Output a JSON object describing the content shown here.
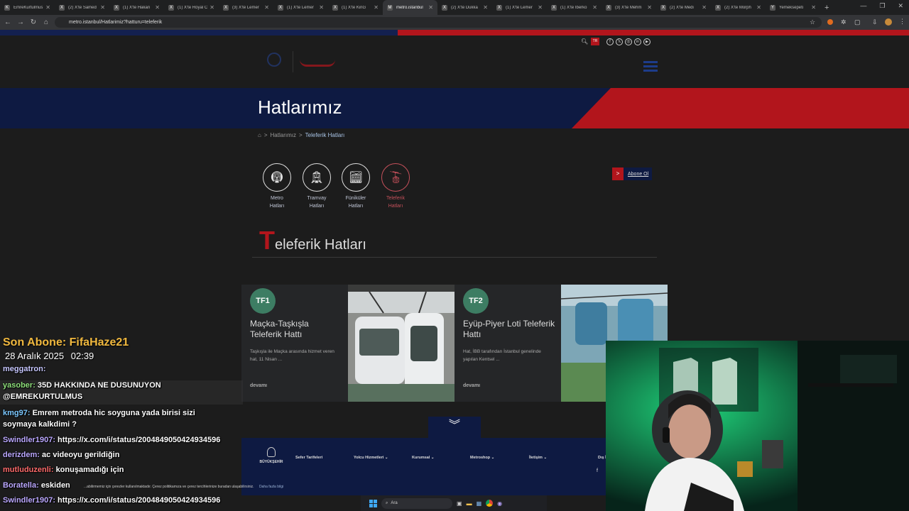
{
  "browser": {
    "tabs": [
      {
        "label": "EmreKurtulmus",
        "active": false,
        "fav": "K"
      },
      {
        "label": "(2) X'te Samed",
        "active": false,
        "fav": "X"
      },
      {
        "label": "(1) X'te Hakan",
        "active": false,
        "fav": "X"
      },
      {
        "label": "(1) X'te Royal C",
        "active": false,
        "fav": "X"
      },
      {
        "label": "(3) X'te Lemer",
        "active": false,
        "fav": "X"
      },
      {
        "label": "(1) X'te Lemer",
        "active": false,
        "fav": "X"
      },
      {
        "label": "(1) X'te KinG",
        "active": false,
        "fav": "X"
      },
      {
        "label": "metro.istanbul",
        "active": true,
        "fav": "M"
      },
      {
        "label": "(2) X'te Dukka",
        "active": false,
        "fav": "X"
      },
      {
        "label": "(1) X'te Lemer",
        "active": false,
        "fav": "X"
      },
      {
        "label": "(1) X'te Iberko",
        "active": false,
        "fav": "X"
      },
      {
        "label": "(3) X'te Mehm",
        "active": false,
        "fav": "X"
      },
      {
        "label": "(2) X'te Medi",
        "active": false,
        "fav": "X"
      },
      {
        "label": "(2) X'te Morph",
        "active": false,
        "fav": "X"
      },
      {
        "label": "Yemeksepeti",
        "active": false,
        "fav": "Y"
      }
    ],
    "url": "metro.istanbul/Hatlarimiz?hatturu=teleferik"
  },
  "header": {
    "lang_badge": "TR"
  },
  "hero": {
    "title": "Hatlarımız"
  },
  "breadcrumb": {
    "sep": ">",
    "parent": "Hatlarımız",
    "current": "Teleferik Hatları"
  },
  "line_types": [
    {
      "line1": "Metro",
      "line2": "Hatları",
      "icon": "metro-icon",
      "active": false
    },
    {
      "line1": "Tramvay",
      "line2": "Hatları",
      "icon": "tram-icon",
      "active": false
    },
    {
      "line1": "Füniküler",
      "line2": "Hatları",
      "icon": "funicular-icon",
      "active": false
    },
    {
      "line1": "Teleferik",
      "line2": "Hatları",
      "icon": "cable-car-icon",
      "active": true
    }
  ],
  "subscribe": {
    "arrow": ">",
    "label": "Abone Ol"
  },
  "section": {
    "initial": "T",
    "rest": "eleferik Hatları"
  },
  "cards": [
    {
      "code": "TF1",
      "title": "Maçka-Taşkışla Teleferik Hattı",
      "desc": "Taşkışla ile Maçka arasında hizmet veren hat, 11 Nisan ...",
      "more": "devamı"
    },
    {
      "code": "TF2",
      "title": "Eyüp-Piyer Loti Teleferik Hattı",
      "desc": "Hat, İBB tarafından İstanbul genelinde yapılan Kentsel ...",
      "more": "devamı"
    }
  ],
  "footer": {
    "logo_text": "BÜYÜKŞEHİR",
    "nav": [
      "Sefer Tarifeleri",
      "Yolcu Hizmetleri",
      "Kurumsal",
      "Metroshop",
      "İletişim",
      "Dış İ"
    ],
    "cookie": "...abilirmemiz için çerezler kullanılmaktadır. Çerez politikamıza ve çerez tercihlerinize buradan ulaşabilirsiniz.",
    "cookie_more": "Daha fazla bilgi"
  },
  "overlay": {
    "last_sub": "Son Abone: FifaHaze21",
    "date": "28 Aralık 2025",
    "time": "02:39",
    "messages": [
      {
        "user": "meggatron:",
        "text": ""
      },
      {
        "user": "yasober:",
        "text": "35D HAKKINDA NE DUSUNUYON"
      },
      {
        "user": "",
        "text": "@EMREKURTULMUS"
      },
      {
        "user": "kmg97:",
        "text": "Emrem metroda hic soyguna yada birisi sizi"
      },
      {
        "user": "",
        "text": "soymaya kalkdimi ?"
      },
      {
        "user": "Swindler1907:",
        "text": "https://x.com/i/status/2004849050424934596"
      },
      {
        "user": "derizdem:",
        "text": "ac videoyu gerildiğin"
      },
      {
        "user": "mutluduzenli:",
        "text": "konuşamadığı için"
      },
      {
        "user": "Boratella:",
        "text": "eskiden"
      },
      {
        "user": "Swindler1907:",
        "text": "https://x.com/i/status/2004849050424934596"
      }
    ]
  },
  "taskbar": {
    "search": "Ara"
  },
  "colors": {
    "brand_red": "#b2151c",
    "navy": "#0e1a42",
    "badge_green": "#3d7d63"
  }
}
